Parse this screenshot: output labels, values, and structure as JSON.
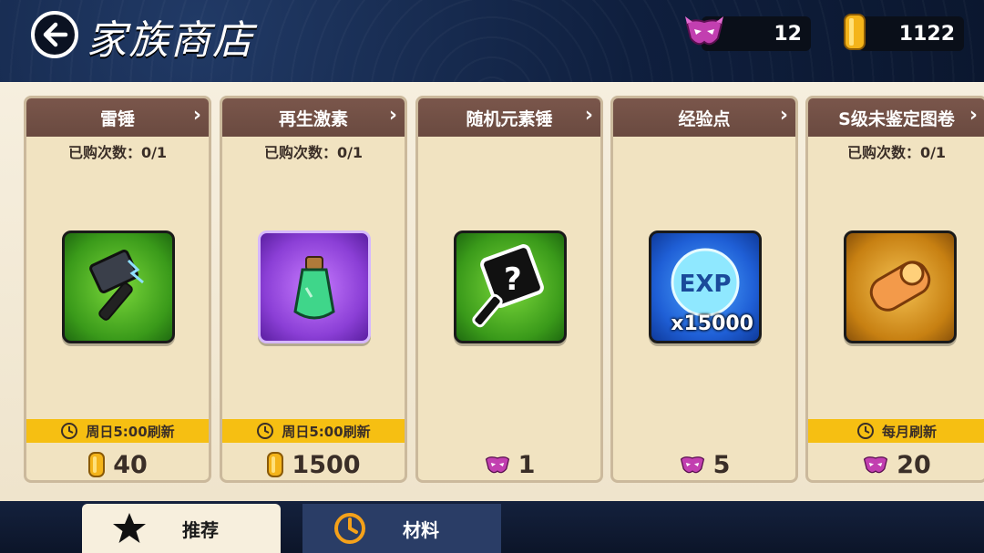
{
  "header": {
    "title": "家族商店",
    "gem_count": "12",
    "gold_count": "1122"
  },
  "cards": [
    {
      "name": "雷锤",
      "count": "已购次数：0/1",
      "refresh": "周日5:00刷新",
      "price": "40",
      "currency": "gold-icon"
    },
    {
      "name": "再生激素",
      "count": "已购次数：0/1",
      "refresh": "周日5:00刷新",
      "price": "1500",
      "currency": "gold-icon"
    },
    {
      "name": "随机元素锤",
      "count": "",
      "refresh": "",
      "price": "1",
      "currency": "mask-gem-icon"
    },
    {
      "name": "经验点",
      "count": "",
      "refresh": "",
      "price": "5",
      "currency": "mask-gem-icon",
      "badge": "x15000",
      "icon_text": "EXP"
    },
    {
      "name": "S级未鉴定图卷",
      "count": "已购次数：0/1",
      "refresh": "每月刷新",
      "price": "20",
      "currency": "mask-gem-icon"
    }
  ],
  "tabs": {
    "recommend": "推荐",
    "material": "材料"
  },
  "colors": {
    "header_bg": "#0f1f3e",
    "card_head": "#6a4a40",
    "refresh_bar": "#f6bf12",
    "card_bg": "#f1e3c1"
  }
}
